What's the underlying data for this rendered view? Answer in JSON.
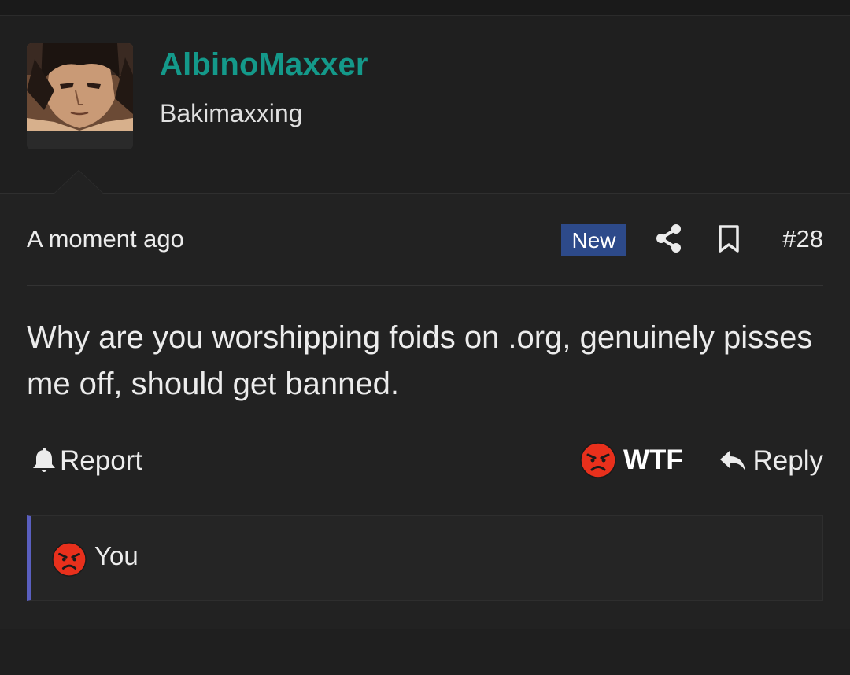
{
  "user": {
    "name": "AlbinoMaxxer",
    "title": "Bakimaxxing",
    "avatar_icon": "avatar-image"
  },
  "meta": {
    "timestamp": "A moment ago",
    "badge": "New",
    "post_number": "#28",
    "share_icon": "share-icon",
    "bookmark_icon": "bookmark-icon"
  },
  "message": {
    "text": "Why are you worshipping foids on .org, genuinely pisses me off, should get banned."
  },
  "actions": {
    "report_label": "Report",
    "reaction_label": "WTF",
    "reply_label": "Reply"
  },
  "reactions": {
    "by_label": "You",
    "emoji": "angry-face-icon"
  },
  "colors": {
    "username": "#14998a",
    "badge_bg": "#2d4a8a",
    "reaction_bar_accent": "#5a5fbf",
    "angry_emoji": "#e8301c"
  }
}
